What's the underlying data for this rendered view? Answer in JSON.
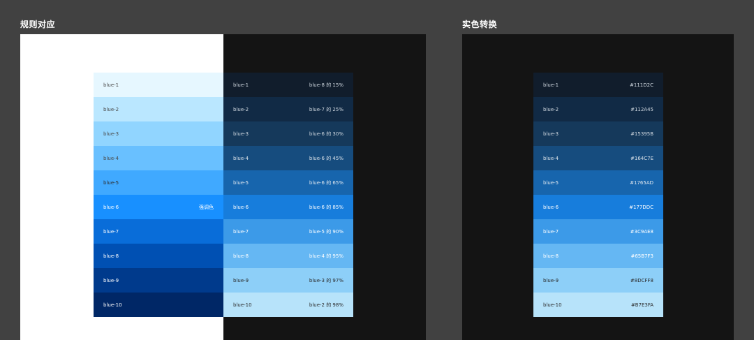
{
  "titles": {
    "left": "规则对应",
    "right": "实色转换"
  },
  "light_palette": [
    {
      "name": "blue-1",
      "note": "",
      "bg": "#E6F7FF",
      "fg": "#4A4A4A"
    },
    {
      "name": "blue-2",
      "note": "",
      "bg": "#BAE7FF",
      "fg": "#4A4A4A"
    },
    {
      "name": "blue-3",
      "note": "",
      "bg": "#91D5FF",
      "fg": "#4A4A4A"
    },
    {
      "name": "blue-4",
      "note": "",
      "bg": "#69C0FF",
      "fg": "#4A4A4A"
    },
    {
      "name": "blue-5",
      "note": "",
      "bg": "#40A9FF",
      "fg": "#2E2E2E"
    },
    {
      "name": "blue-6",
      "note": "强调色",
      "bg": "#1890FF",
      "fg": "#FFFFFF"
    },
    {
      "name": "blue-7",
      "note": "",
      "bg": "#096DD9",
      "fg": "#FFFFFF"
    },
    {
      "name": "blue-8",
      "note": "",
      "bg": "#0050B3",
      "fg": "#FFFFFF"
    },
    {
      "name": "blue-9",
      "note": "",
      "bg": "#003A8C",
      "fg": "#FFFFFF"
    },
    {
      "name": "blue-10",
      "note": "",
      "bg": "#002766",
      "fg": "#FFFFFF"
    }
  ],
  "dark_rule_palette": [
    {
      "name": "blue-1",
      "rule": "blue-8 的 15%",
      "bg": "#111D2C",
      "fg": "#D0D8E0"
    },
    {
      "name": "blue-2",
      "rule": "blue-7 的 25%",
      "bg": "#112A45",
      "fg": "#D0D8E0"
    },
    {
      "name": "blue-3",
      "rule": "blue-6 的 30%",
      "bg": "#15395B",
      "fg": "#D0D8E0"
    },
    {
      "name": "blue-4",
      "rule": "blue-6 的 45%",
      "bg": "#164C7E",
      "fg": "#D8E0E8"
    },
    {
      "name": "blue-5",
      "rule": "blue-6 的 65%",
      "bg": "#1765AD",
      "fg": "#E0E8F0"
    },
    {
      "name": "blue-6",
      "rule": "blue-6 的 85%",
      "bg": "#177DDC",
      "fg": "#FFFFFF"
    },
    {
      "name": "blue-7",
      "rule": "blue-5 的 90%",
      "bg": "#3C9AE8",
      "fg": "#FFFFFF"
    },
    {
      "name": "blue-8",
      "rule": "blue-4 的 95%",
      "bg": "#65B7F3",
      "fg": "#FFFFFF"
    },
    {
      "name": "blue-9",
      "rule": "blue-3 的 97%",
      "bg": "#8DCFF8",
      "fg": "#2A2A2A"
    },
    {
      "name": "blue-10",
      "rule": "blue-2 的 98%",
      "bg": "#B7E3FA",
      "fg": "#2A2A2A"
    }
  ],
  "solid_palette": [
    {
      "name": "blue-1",
      "hex": "#111D2C",
      "bg": "#111D2C",
      "fg": "#D0D8E0"
    },
    {
      "name": "blue-2",
      "hex": "#112A45",
      "bg": "#112A45",
      "fg": "#D0D8E0"
    },
    {
      "name": "blue-3",
      "hex": "#15395B",
      "bg": "#15395B",
      "fg": "#D0D8E0"
    },
    {
      "name": "blue-4",
      "hex": "#164C7E",
      "bg": "#164C7E",
      "fg": "#D8E0E8"
    },
    {
      "name": "blue-5",
      "hex": "#1765AD",
      "bg": "#1765AD",
      "fg": "#E0E8F0"
    },
    {
      "name": "blue-6",
      "hex": "#177DDC",
      "bg": "#177DDC",
      "fg": "#FFFFFF"
    },
    {
      "name": "blue-7",
      "hex": "#3C9AE8",
      "bg": "#3C9AE8",
      "fg": "#FFFFFF"
    },
    {
      "name": "blue-8",
      "hex": "#65B7F3",
      "bg": "#65B7F3",
      "fg": "#FFFFFF"
    },
    {
      "name": "blue-9",
      "hex": "#8DCFF8",
      "bg": "#8DCFF8",
      "fg": "#2A2A2A"
    },
    {
      "name": "blue-10",
      "hex": "#B7E3FA",
      "bg": "#B7E3FA",
      "fg": "#2A2A2A"
    }
  ]
}
